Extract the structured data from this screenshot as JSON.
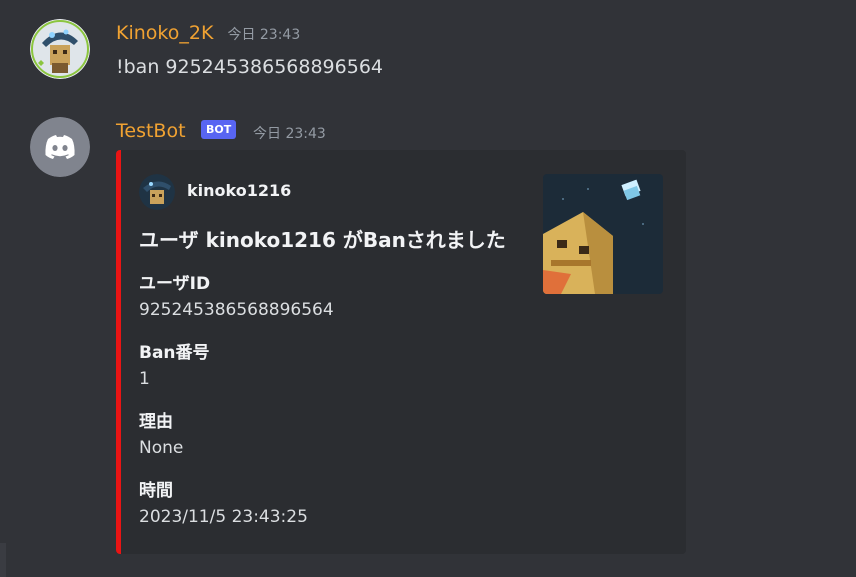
{
  "messages": [
    {
      "author": "Kinoko_2K",
      "author_color": "#f0a232",
      "timestamp": "今日 23:43",
      "content": "!ban 925245386568896564"
    },
    {
      "author": "TestBot",
      "author_color": "#f0a232",
      "badge": "BOT",
      "timestamp": "今日 23:43",
      "embed": {
        "color": "#e91414",
        "author_name": "kinoko1216",
        "title": "ユーザ kinoko1216 がBanされました",
        "fields": [
          {
            "name": "ユーザID",
            "value": "925245386568896564"
          },
          {
            "name": "Ban番号",
            "value": "1"
          },
          {
            "name": "理由",
            "value": "None"
          },
          {
            "name": "時間",
            "value": "2023/11/5 23:43:25"
          }
        ]
      }
    }
  ]
}
